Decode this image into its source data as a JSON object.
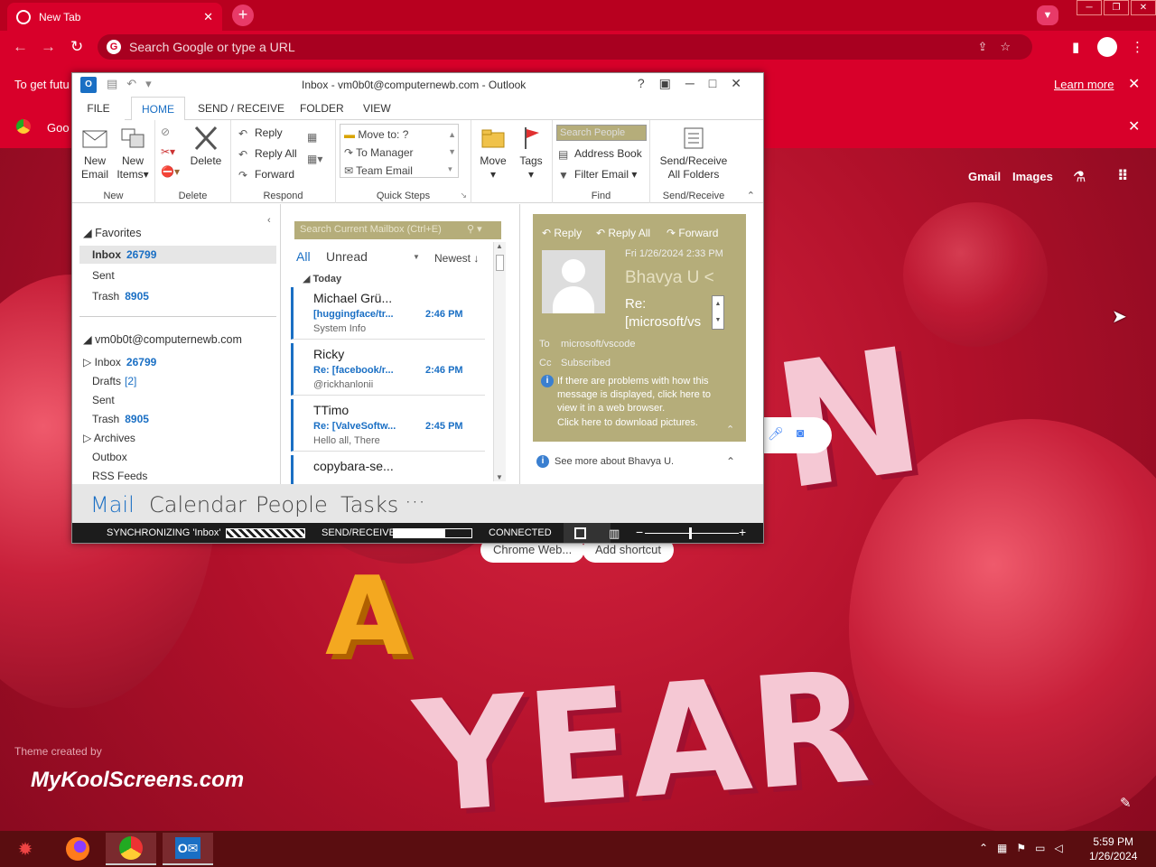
{
  "browser": {
    "tab_title": "New Tab",
    "omnibox_placeholder": "Search Google or type a URL",
    "infobar_text": "To get futu",
    "learn_more": "Learn more",
    "infobar2_text": "Goo",
    "ntp_links": [
      "Gmail",
      "Images"
    ],
    "shortcuts": [
      "Chrome Web...",
      "Add shortcut"
    ],
    "theme_credit": "Theme created by",
    "brand": "MyKoolScreens.com"
  },
  "outlook": {
    "title": "Inbox - vm0b0t@computernewb.com - Outlook",
    "tabs": [
      "FILE",
      "HOME",
      "SEND / RECEIVE",
      "FOLDER",
      "VIEW"
    ],
    "ribbon": {
      "new_email": "New\nEmail",
      "new_email_l1": "New",
      "new_email_l2": "Email",
      "new_items_l1": "New",
      "new_items_l2": "Items",
      "delete": "Delete",
      "reply": "Reply",
      "reply_all": "Reply All",
      "forward": "Forward",
      "quick_steps": [
        "Move to: ?",
        "To Manager",
        "Team Email"
      ],
      "move": "Move",
      "tags": "Tags",
      "search_people": "Search People",
      "address_book": "Address Book",
      "filter_email": "Filter Email",
      "send_receive_l1": "Send/Receive",
      "send_receive_l2": "All Folders",
      "groups": [
        "New",
        "Delete",
        "Respond",
        "Quick Steps",
        "Find",
        "Send/Receive"
      ]
    },
    "folders": {
      "favorites_label": "Favorites",
      "favorites": [
        {
          "name": "Inbox",
          "count": "26799"
        },
        {
          "name": "Sent",
          "count": ""
        },
        {
          "name": "Trash",
          "count": "8905"
        }
      ],
      "account": "vm0b0t@computernewb.com",
      "account_folders": [
        {
          "name": "Inbox",
          "count": "26799"
        },
        {
          "name": "Drafts",
          "count": "[2]"
        },
        {
          "name": "Sent",
          "count": ""
        },
        {
          "name": "Trash",
          "count": "8905"
        },
        {
          "name": "Archives",
          "count": ""
        },
        {
          "name": "Outbox",
          "count": ""
        },
        {
          "name": "RSS Feeds",
          "count": ""
        }
      ]
    },
    "list": {
      "search_placeholder": "Search Current Mailbox (Ctrl+E)",
      "filter_all": "All",
      "filter_unread": "Unread",
      "sort": "Newest",
      "group": "Today",
      "messages": [
        {
          "from": "Michael Grü...",
          "subject": "[huggingface/tr...",
          "time": "2:46 PM",
          "preview": "System Info"
        },
        {
          "from": "Ricky",
          "subject": "Re: [facebook/r...",
          "time": "2:46 PM",
          "preview": "@rickhanlonii"
        },
        {
          "from": "TTimo",
          "subject": "Re: [ValveSoftw...",
          "time": "2:45 PM",
          "preview": "Hello all,  There"
        },
        {
          "from": "copybara-se...",
          "subject": "",
          "time": "",
          "preview": ""
        }
      ]
    },
    "reading": {
      "actions": [
        "Reply",
        "Reply All",
        "Forward"
      ],
      "date": "Fri 1/26/2024 2:33 PM",
      "sender": "Bhavya U <",
      "subject_l1": "Re:",
      "subject_l2": "[microsoft/vs",
      "to_label": "To",
      "to": "microsoft/vscode",
      "cc_label": "Cc",
      "cc": "Subscribed",
      "info": "If there are problems with how this message is displayed, click here to view it in a web browser.",
      "info2": "Click here to download pictures.",
      "see_more": "See more about Bhavya U."
    },
    "nav": [
      "Mail",
      "Calendar",
      "People",
      "Tasks",
      "···"
    ],
    "status": {
      "sync": "SYNCHRONIZING  'Inbox'",
      "send_receive": "SEND/RECEIVE",
      "connected": "CONNECTED"
    }
  },
  "taskbar": {
    "time": "5:59 PM",
    "date": "1/26/2024"
  },
  "colors": {
    "accent": "#1a6fc4",
    "outlook_tan": "#b5ad7a",
    "chrome_red": "#d8002a"
  }
}
